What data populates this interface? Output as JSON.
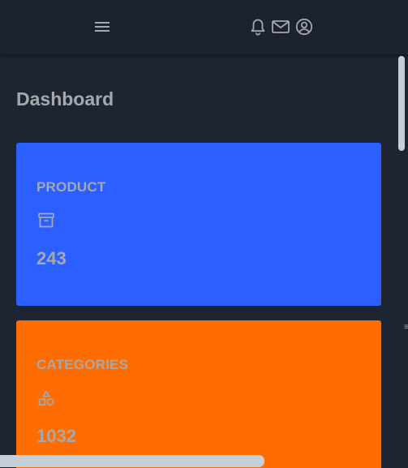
{
  "header": {
    "icons": {
      "menu": "hamburger-menu-icon",
      "notifications": "bell-icon",
      "messages": "mail-icon",
      "profile": "user-circle-icon"
    }
  },
  "main": {
    "title": "Dashboard",
    "cards": [
      {
        "label": "PRODUCT",
        "icon": "archive-box-icon",
        "value": "243",
        "color": "#2b5fff"
      },
      {
        "label": "CATEGORIES",
        "icon": "shapes-icon",
        "value": "1032",
        "color": "#ff6d00"
      }
    ]
  },
  "edge_glyph": "≡",
  "colors": {
    "background": "#1e2532",
    "topbar": "#1c2230",
    "text_muted": "#a5a8ad",
    "scrollbar": "#c6cfd8"
  }
}
